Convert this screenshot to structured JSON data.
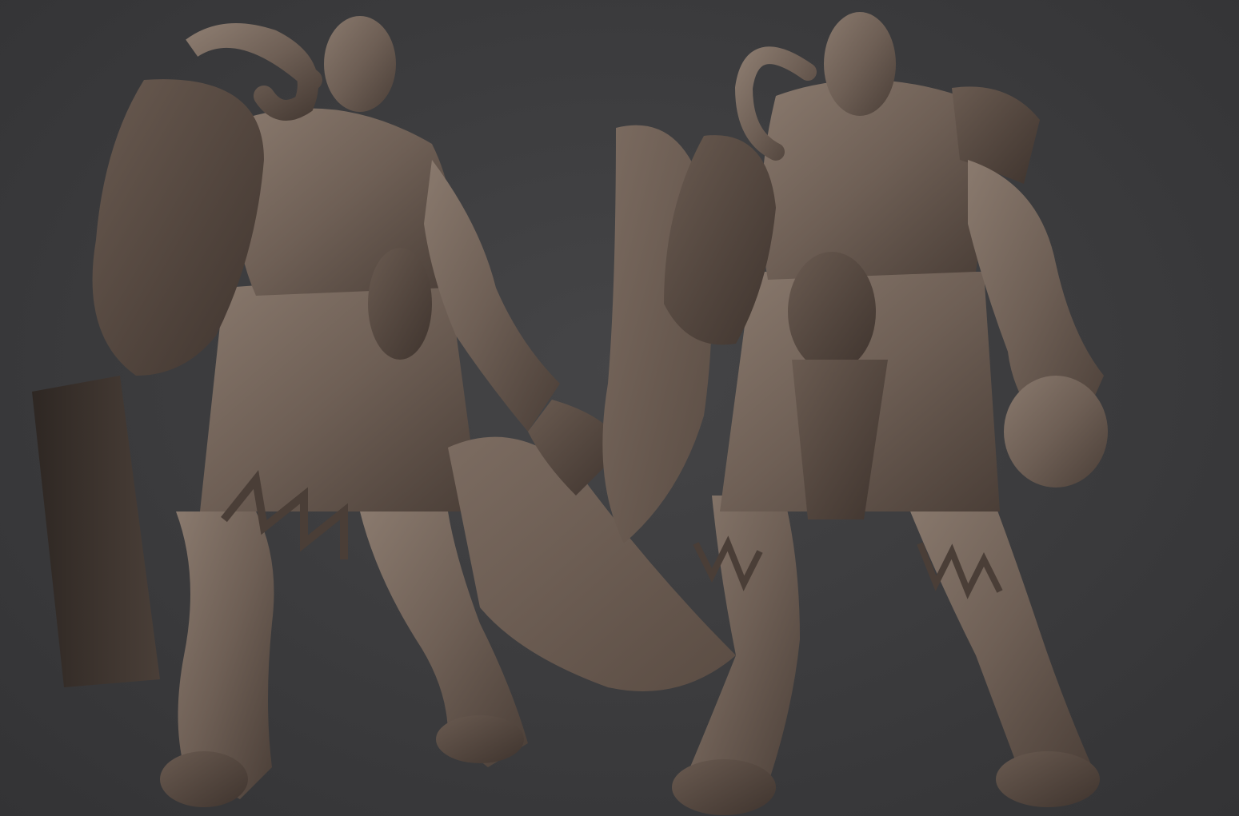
{
  "scene": {
    "background_color": "#3b3b3d",
    "model_color": "#6e5f55",
    "model_highlight": "#8d7d71",
    "model_shadow": "#3f342e",
    "figures": [
      {
        "name": "orc-side-view",
        "holds": "cleaver-and-shield"
      },
      {
        "name": "orc-front-view",
        "holds": "cleaver"
      }
    ]
  }
}
